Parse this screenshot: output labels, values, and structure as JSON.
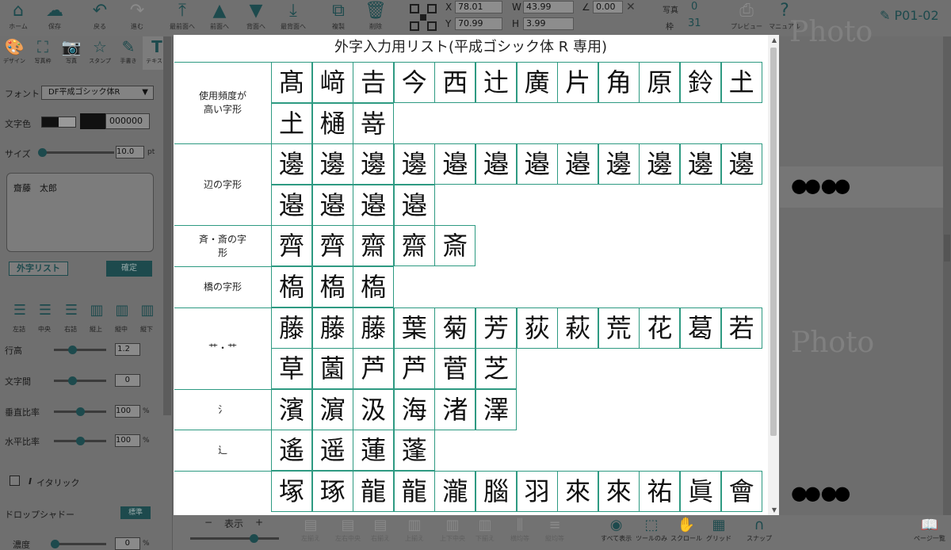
{
  "toolbar": {
    "buttons": [
      {
        "label": "ホーム",
        "icon": "home-icon"
      },
      {
        "label": "保存",
        "icon": "cloud-upload-icon"
      },
      {
        "label": "戻る",
        "icon": "undo-icon"
      },
      {
        "label": "進む",
        "icon": "redo-icon"
      },
      {
        "label": "最前面へ",
        "icon": "bring-front-icon"
      },
      {
        "label": "前面へ",
        "icon": "bring-forward-icon"
      },
      {
        "label": "背面へ",
        "icon": "send-backward-icon"
      },
      {
        "label": "最背面へ",
        "icon": "send-back-icon"
      },
      {
        "label": "複製",
        "icon": "duplicate-icon"
      },
      {
        "label": "削除",
        "icon": "trash-icon"
      }
    ],
    "coords": {
      "x_label": "X",
      "x": "78.01",
      "y_label": "Y",
      "y": "70.99",
      "w_label": "W",
      "w": "43.99",
      "h_label": "H",
      "h": "3.99",
      "angle_label": "∠",
      "angle": "0.00"
    },
    "counters": {
      "photo_label": "写真",
      "photo_value": "0",
      "frame_label": "枠",
      "frame_value": "31"
    },
    "preview_label": "プレビュー",
    "manual_label": "マニュアル",
    "page_name": "P01-02"
  },
  "left_panel": {
    "tabs": [
      "デザイン",
      "写真枠",
      "写真",
      "スタンプ",
      "手書き",
      "テキスト"
    ],
    "font_label": "フォント",
    "font_value": "DF平成ゴシック体R",
    "color_label": "文字色",
    "color_value": "000000",
    "size_label": "サイズ",
    "size_value": "10.0",
    "size_unit": "pt",
    "text_value": "齋藤　太郎",
    "gaiji_button": "外字リスト",
    "confirm_button": "確定",
    "align_labels": [
      "左詰",
      "中央",
      "右詰",
      "縦上",
      "縦中",
      "縦下"
    ],
    "line_height_label": "行高",
    "line_height_value": "1.2",
    "letter_spacing_label": "文字間",
    "letter_spacing_value": "0",
    "vertical_ratio_label": "垂直比率",
    "vertical_ratio_value": "100",
    "horizontal_ratio_label": "水平比率",
    "horizontal_ratio_value": "100",
    "percent_unit": "%",
    "italic_label": "イタリック",
    "italic_symbol": "I",
    "drop_shadow_label": "ドロップシャドー",
    "drop_shadow_badge": "標準",
    "density_label": "濃度",
    "density_value": "0"
  },
  "canvas": {
    "photo_text": "Photo",
    "dots": "●● ●●"
  },
  "bottom_bar": {
    "zoom_minus": "−",
    "zoom_label": "表示",
    "zoom_plus": "+",
    "items": [
      {
        "label": "左揃え",
        "icon": "align-left-icon",
        "enabled": false
      },
      {
        "label": "左右中央",
        "icon": "align-center-icon",
        "enabled": false
      },
      {
        "label": "右揃え",
        "icon": "align-right-icon",
        "enabled": false
      },
      {
        "label": "上揃え",
        "icon": "align-top-icon",
        "enabled": false
      },
      {
        "label": "上下中央",
        "icon": "align-middle-icon",
        "enabled": false
      },
      {
        "label": "下揃え",
        "icon": "align-bottom-icon",
        "enabled": false
      },
      {
        "label": "横均等",
        "icon": "distribute-h-icon",
        "enabled": false
      },
      {
        "label": "縦均等",
        "icon": "distribute-v-icon",
        "enabled": false
      },
      {
        "label": "すべて表示",
        "icon": "eye-icon",
        "enabled": true
      },
      {
        "label": "ツールのみ",
        "icon": "select-tool-icon",
        "enabled": true
      },
      {
        "label": "スクロール",
        "icon": "hand-icon",
        "enabled": true
      },
      {
        "label": "グリッド",
        "icon": "grid-icon",
        "enabled": true
      },
      {
        "label": "スナップ",
        "icon": "magnet-icon",
        "enabled": true
      },
      {
        "label": "ページ一覧",
        "icon": "book-icon",
        "enabled": true
      }
    ]
  },
  "modal": {
    "title": "外字入力用リスト(平成ゴシック体 R 専用)",
    "groups": [
      {
        "label": "使用頻度が\n高い字形",
        "chars": [
          "髙",
          "﨑",
          "𠮷",
          "今",
          "西",
          "辻",
          "廣",
          "片",
          "角",
          "原",
          "鈴",
          "𡈽",
          "𡈽",
          "樋",
          "嵜"
        ]
      },
      {
        "label": "辺の字形",
        "chars": [
          "邊",
          "邊",
          "邊",
          "邊",
          "邉",
          "邉",
          "邉",
          "邉",
          "邊",
          "邊",
          "邊",
          "邊",
          "邉",
          "邉",
          "邉",
          "邉"
        ]
      },
      {
        "label": "斉・斎の字\n形",
        "chars": [
          "齊",
          "齊",
          "齋",
          "齋",
          "斎"
        ]
      },
      {
        "label": "橋の字形",
        "chars": [
          "槗",
          "槗",
          "槗"
        ]
      },
      {
        "label": "艹・艹",
        "chars": [
          "藤",
          "藤",
          "藤",
          "葉",
          "菊",
          "芳",
          "荻",
          "萩",
          "荒",
          "花",
          "葛",
          "若",
          "草",
          "薗",
          "芦",
          "芦",
          "菅",
          "芝"
        ]
      },
      {
        "label": "氵",
        "chars": [
          "濱",
          "濵",
          "汲",
          "海",
          "渚",
          "澤"
        ]
      },
      {
        "label": "辶",
        "chars": [
          "遙",
          "遥",
          "蓮",
          "蓬"
        ]
      },
      {
        "label": "",
        "chars": [
          "塚",
          "琢",
          "龍",
          "龍",
          "瀧",
          "腦",
          "羽",
          "來",
          "來",
          "祐",
          "眞",
          "會"
        ]
      }
    ]
  }
}
